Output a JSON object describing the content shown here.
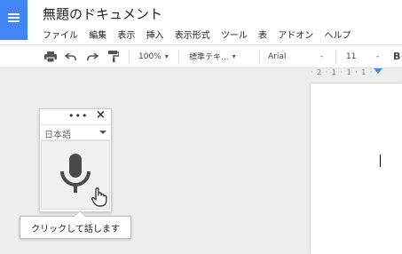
{
  "header": {
    "title": "無題のドキュメント",
    "menu": [
      "ファイル",
      "編集",
      "表示",
      "挿入",
      "表示形式",
      "ツール",
      "表",
      "アドオン",
      "ヘルプ"
    ]
  },
  "toolbar": {
    "print_icon": "print-icon",
    "undo_icon": "undo-icon",
    "redo_icon": "redo-icon",
    "paint_format_icon": "paint-format-icon",
    "zoom": "100%",
    "style": "標準テキ...",
    "font": "Arial",
    "font_size": "11",
    "bold": "B",
    "minus": "-"
  },
  "ruler": {
    "text": "· 2 · 1 · 1 · 1 ·"
  },
  "voice_typing": {
    "more_icon": "more-horizontal-icon",
    "close_icon": "close-icon",
    "language": "日本語",
    "mic_icon": "microphone-icon",
    "hand_cursor_icon": "hand-pointer-icon",
    "tooltip": "クリックして話します"
  },
  "colors": {
    "brand_blue": "#4285f4",
    "mic_dark": "#4a4a4a"
  }
}
